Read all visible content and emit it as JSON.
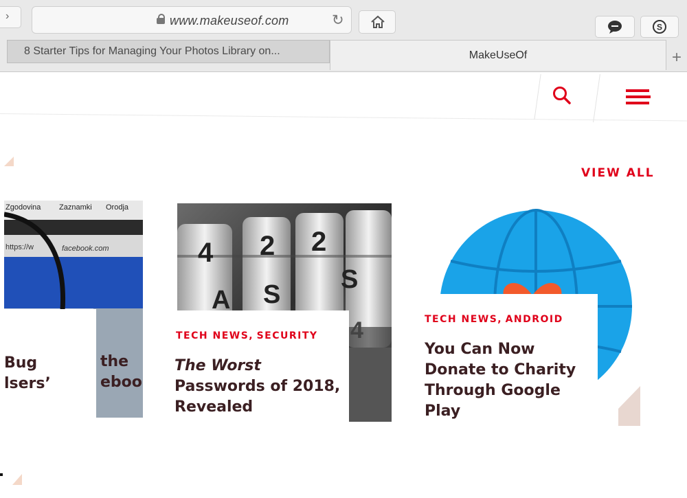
{
  "browser": {
    "url": "www.makeuseof.com",
    "tabs": [
      {
        "label": "8 Starter Tips for Managing Your Photos Library on..."
      },
      {
        "label": "MakeUseOf"
      }
    ],
    "new_tab_label": "+"
  },
  "site": {
    "view_all": "VIEW ALL",
    "accent_color": "#e0001a"
  },
  "cards": [
    {
      "tags": [],
      "title_lines": [
        "Bug",
        "lsers’"
      ],
      "title_right_lines": [
        "the",
        "ebook"
      ],
      "image_texts": {
        "menu": [
          "Zgodovina",
          "Zaznamki",
          "Orodja"
        ],
        "address": "https://w",
        "address2": "facebook.com"
      }
    },
    {
      "tags": [
        "TECH NEWS,",
        "SECURITY"
      ],
      "title_lines": [
        "The Worst",
        "Passwords of 2018,",
        "Revealed"
      ],
      "image_texts": {
        "dial_chars": [
          "4",
          "2",
          "2",
          "A",
          "S",
          "S",
          "4"
        ]
      }
    },
    {
      "tags": [
        "TECH NEWS,",
        "ANDROID"
      ],
      "title_lines": [
        "You Can Now",
        "Donate to Charity",
        "Through Google",
        "Play"
      ]
    }
  ],
  "icons": {
    "search": "search-icon",
    "menu": "hamburger-menu-icon",
    "home": "home-icon",
    "reload": "reload-icon",
    "lock": "lock-icon",
    "chat": "chat-bubble-icon",
    "skype": "skype-icon"
  }
}
